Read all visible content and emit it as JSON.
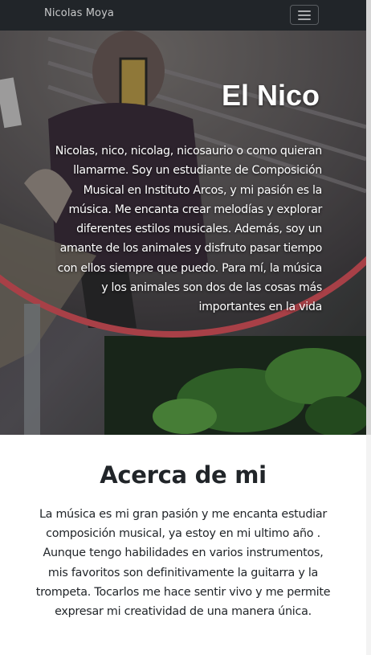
{
  "navbar": {
    "brand": "Nicolas Moya",
    "menu_icon": "hamburger-icon"
  },
  "hero": {
    "title": "El Nico",
    "text": "Nicolas, nico, nicolag, nicosaurio o como quieran llamarme. Soy un estudiante de Composición Musical en Instituto Arcos, y mi pasión es la música. Me encanta crear melodías y explorar diferentes estilos musicales. Además, soy un amante de los animales y disfruto pasar tiempo con ellos siempre que puedo. Para mí, la música y los animales son dos de las cosas más importantes en la vida"
  },
  "about": {
    "title": "Acerca de mi",
    "text": "La música es mi gran pasión y me encanta estudiar composición musical, ya estoy en mi ultimo año . Aunque tengo habilidades en varios instrumentos, mis favoritos son definitivamente la guitarra y la trompeta. Tocarlos me hace sentir vivo y me permite expresar mi creatividad de una manera única."
  },
  "colors": {
    "navbar_bg": "#212529",
    "mirror_frame": "#d8525c",
    "text_dark": "#212529"
  }
}
